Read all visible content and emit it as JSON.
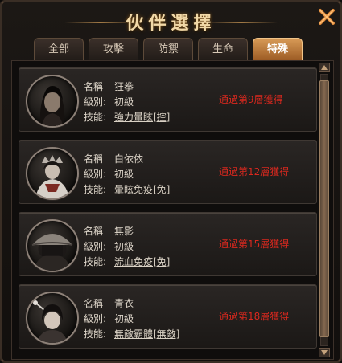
{
  "window": {
    "title": "伙伴選擇"
  },
  "tabs": [
    {
      "label": "全部"
    },
    {
      "label": "攻擊"
    },
    {
      "label": "防禦"
    },
    {
      "label": "生命"
    },
    {
      "label": "特殊",
      "active": true
    }
  ],
  "field_labels": {
    "name": "名稱",
    "level": "級別:",
    "skill": "技能:"
  },
  "companions": [
    {
      "name": "狂拳",
      "level": "初級",
      "skill": "強力暈眩[控]",
      "obtain": "通過第9層獲得",
      "portrait": "long-hair-man-portrait-icon"
    },
    {
      "name": "白依依",
      "level": "初級",
      "skill": "暈眩免疫[免]",
      "obtain": "通過第12層獲得",
      "portrait": "crowned-woman-portrait-icon"
    },
    {
      "name": "無影",
      "level": "初級",
      "skill": "流血免疫[免]",
      "obtain": "通過第15層獲得",
      "portrait": "straw-hat-warrior-portrait-icon"
    },
    {
      "name": "青衣",
      "level": "初級",
      "skill": "無敵霸體[無敵]",
      "obtain": "通過第18層獲得",
      "portrait": "hair-ornament-woman-portrait-icon"
    }
  ],
  "colors": {
    "obtain_text": "#d8281e",
    "active_tab": "#c07a3a",
    "title_text": "#f2d9a8"
  }
}
